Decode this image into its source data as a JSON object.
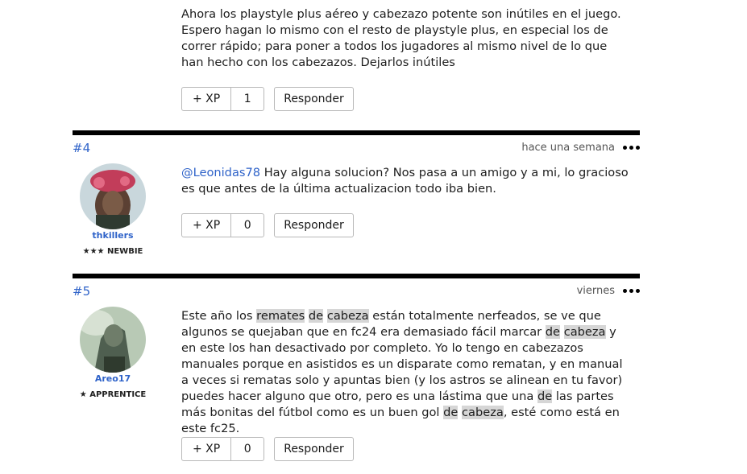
{
  "post3": {
    "text": "Ahora los playstyle plus aéreo y cabezazo potente son inútiles en el juego. Espero hagan lo mismo con el resto de playstyle plus, en especial los de correr rápido; para poner a todos los jugadores  al mismo nivel de lo que han hecho con los cabezazos. Dejarlos inútiles",
    "xp_label": "+ XP",
    "xp_count": "1",
    "reply_label": "Responder"
  },
  "post4": {
    "number": "#4",
    "time": "hace una semana",
    "username": "thkillers",
    "rank": "★★★ NEWBIE",
    "mention": "@Leonidas78",
    "text": " Hay alguna solucion? Nos pasa a un amigo y a mi, lo gracioso es que antes de la última actualizacion todo iba bien.",
    "xp_label": "+ XP",
    "xp_count": "0",
    "reply_label": "Responder"
  },
  "post5": {
    "number": "#5",
    "time": "viernes",
    "username": "Areo17",
    "rank": "★ APPRENTICE",
    "text_parts": [
      "Este año los ",
      "remates",
      " ",
      "de",
      " ",
      "cabeza",
      " están totalmente nerfeados, se ve que algunos se quejaban que en fc24 era demasiado fácil marcar ",
      "de",
      " ",
      "cabeza",
      " y en este los han desactivado por completo. Yo lo tengo en cabezazos manuales porque en asistidos es un disparate como rematan, y en manual a veces si rematas solo y apuntas bien (y los astros se alinean en tu favor) puedes hacer alguno que otro, pero es una lástima que una ",
      "de",
      " las partes más bonitas del fútbol como es un buen gol ",
      "de",
      " ",
      "cabeza",
      ", esté como está en este fc25."
    ],
    "xp_label": "+ XP",
    "xp_count": "0",
    "reply_label": "Responder"
  },
  "icons": {
    "more": "more-dots-icon"
  },
  "colors": {
    "accent": "#2f63c9",
    "divider": "#000000",
    "highlight": "#d6d6d6"
  }
}
